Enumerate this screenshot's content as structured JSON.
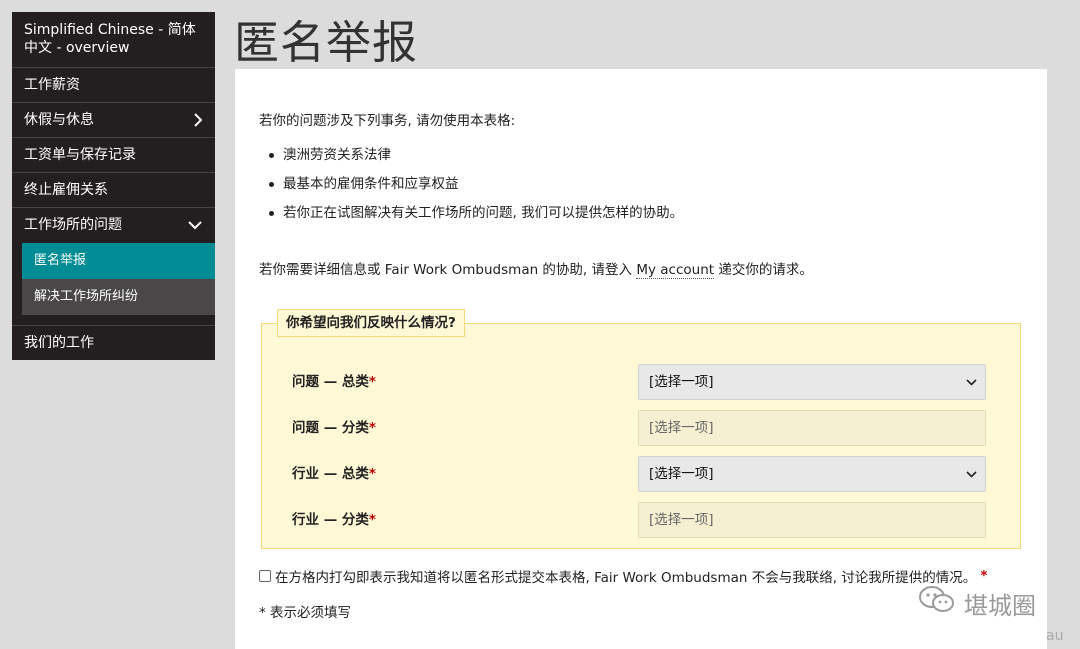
{
  "sidebar": {
    "title": "Simplified Chinese - 简体中文 - overview",
    "items": [
      {
        "label": "工作薪资"
      },
      {
        "label": "休假与休息"
      },
      {
        "label": "工资单与保存记录"
      },
      {
        "label": "终止雇佣关系"
      },
      {
        "label": "工作场所的问题"
      }
    ],
    "sub_items": [
      {
        "label": "匿名举报",
        "active": true
      },
      {
        "label": "解决工作场所纠纷",
        "active": false
      }
    ],
    "last_item": {
      "label": "我们的工作"
    }
  },
  "page": {
    "title": "匿名举报"
  },
  "content": {
    "intro": "若你的问题涉及下列事务, 请勿使用本表格:",
    "bullets": [
      "澳洲劳资关系法律",
      "最基本的雇佣条件和应享权益",
      "若你正在试图解决有关工作场所的问题, 我们可以提供怎样的协助。"
    ],
    "login_prefix": "若你需要详细信息或 Fair Work Ombudsman 的协助, 请登入",
    "login_link": "My account",
    "login_suffix": "递交你的请求。"
  },
  "form": {
    "legend": "你希望向我们反映什么情况?",
    "required_mark": "*",
    "fields": [
      {
        "label": "问题 — 总类",
        "value": "[选择一项]",
        "disabled": false
      },
      {
        "label": "问题 — 分类",
        "value": "[选择一项]",
        "disabled": true
      },
      {
        "label": "行业 — 总类",
        "value": "[选择一项]",
        "disabled": false
      },
      {
        "label": "行业 — 分类",
        "value": "[选择一项]",
        "disabled": true
      }
    ],
    "checkbox_label": "在方格内打勾即表示我知道将以匿名形式提交本表格, Fair Work Ombudsman 不会与我联络, 讨论我所提供的情况。",
    "required_note": "* 表示必须填写"
  },
  "watermark": {
    "text": "堪城圈",
    "domain_fragment": "au"
  },
  "colors": {
    "sidebar_bg": "#231f20",
    "active_sub": "#008c95",
    "fieldset_bg": "#fff8d6",
    "required": "#bb0000"
  }
}
